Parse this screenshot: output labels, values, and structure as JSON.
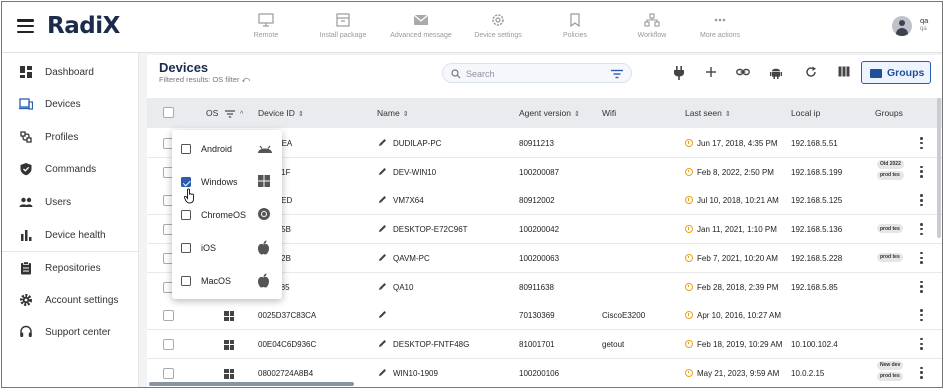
{
  "app": {
    "logo_text": "Radi",
    "logo_x": "X"
  },
  "toolbar": [
    {
      "label": "Remote",
      "icon": "monitor-icon"
    },
    {
      "label": "Install package",
      "icon": "package-icon"
    },
    {
      "label": "Advanced message",
      "icon": "envelope-icon"
    },
    {
      "label": "Device settings",
      "icon": "gear-icon"
    },
    {
      "label": "Policies",
      "icon": "bookmark-icon"
    },
    {
      "label": "Workflow",
      "icon": "workflow-icon"
    },
    {
      "label": "More actions",
      "icon": "dots-icon"
    }
  ],
  "user": {
    "name": "qa",
    "sub": "qa"
  },
  "sidebar": [
    {
      "label": "Dashboard",
      "icon": "dashboard-icon"
    },
    {
      "label": "Devices",
      "icon": "devices-icon"
    },
    {
      "label": "Profiles",
      "icon": "profiles-icon"
    },
    {
      "label": "Commands",
      "icon": "shield-icon"
    },
    {
      "label": "Users",
      "icon": "users-icon"
    },
    {
      "label": "Device health",
      "icon": "bar-chart-icon"
    },
    {
      "label": "Repositories",
      "icon": "clipboard-icon"
    },
    {
      "label": "Account settings",
      "icon": "gear-icon"
    },
    {
      "label": "Support center",
      "icon": "headset-icon"
    }
  ],
  "page": {
    "title": "Devices",
    "subtitle": "Filtered results: OS filter",
    "search_placeholder": "Search",
    "groups_button": "Groups"
  },
  "table": {
    "columns": [
      "OS",
      "Device ID",
      "Name",
      "Agent version",
      "Wifi",
      "Last seen",
      "Local ip",
      "Groups"
    ],
    "rows": [
      {
        "device_id": "A337FEA",
        "name": "DUDILAP-PC",
        "agent": "80911213",
        "wifi": "",
        "last_seen": "Jun 17, 2018, 4:35 PM",
        "ip": "192.168.5.51",
        "groups": []
      },
      {
        "device_id": "951A81F",
        "name": "DEV-WIN10",
        "agent": "100200087",
        "wifi": "",
        "last_seen": "Feb 8, 2022, 2:50 PM",
        "ip": "192.168.5.199",
        "groups": [
          "Old 2022",
          "prod tes"
        ]
      },
      {
        "device_id": "9705AED",
        "name": "VM7X64",
        "agent": "80912002",
        "wifi": "",
        "last_seen": "Jul 10, 2018, 10:21 AM",
        "ip": "192.168.5.125",
        "groups": []
      },
      {
        "device_id": "9734B5B",
        "name": "DESKTOP-E72C96T",
        "agent": "100200042",
        "wifi": "",
        "last_seen": "Jan 11, 2021, 1:10 PM",
        "ip": "192.168.5.136",
        "groups": [
          "prod tes"
        ]
      },
      {
        "device_id": "97E392B",
        "name": "QAVM-PC",
        "agent": "100200063",
        "wifi": "",
        "last_seen": "Feb 7, 2021, 10:20 AM",
        "ip": "192.168.5.228",
        "groups": [
          "prod tes"
        ]
      },
      {
        "device_id": "051F085",
        "name": "QA10",
        "agent": "80911638",
        "wifi": "",
        "last_seen": "Feb 28, 2018, 2:39 PM",
        "ip": "192.168.5.85",
        "groups": []
      },
      {
        "device_id": "0025D37C83CA",
        "name": "",
        "agent": "70130369",
        "wifi": "CiscoE3200",
        "last_seen": "Apr 10, 2016, 10:27 AM",
        "ip": "",
        "groups": []
      },
      {
        "device_id": "00E04C6D936C",
        "name": "DESKTOP-FNTF48G",
        "agent": "81001701",
        "wifi": "getout",
        "last_seen": "Feb 18, 2019, 10:29 AM",
        "ip": "10.100.102.4",
        "groups": []
      },
      {
        "device_id": "08002724A8B4",
        "name": "WIN10-1909",
        "agent": "100200106",
        "wifi": "",
        "last_seen": "May 21, 2023, 9:59 AM",
        "ip": "10.0.2.15",
        "groups": [
          "New dev",
          "prod tes"
        ]
      }
    ]
  },
  "os_filter": [
    {
      "label": "Android",
      "checked": false,
      "icon": "android-icon"
    },
    {
      "label": "Windows",
      "checked": true,
      "icon": "windows-icon"
    },
    {
      "label": "ChromeOS",
      "checked": false,
      "icon": "chrome-icon"
    },
    {
      "label": "iOS",
      "checked": false,
      "icon": "apple-icon"
    },
    {
      "label": "MacOS",
      "checked": false,
      "icon": "apple-icon"
    }
  ],
  "colors": {
    "accent": "#2a5db0",
    "brand": "#1a2b4c",
    "clock": "#e9a21c",
    "header_bg": "#e9ebee"
  }
}
